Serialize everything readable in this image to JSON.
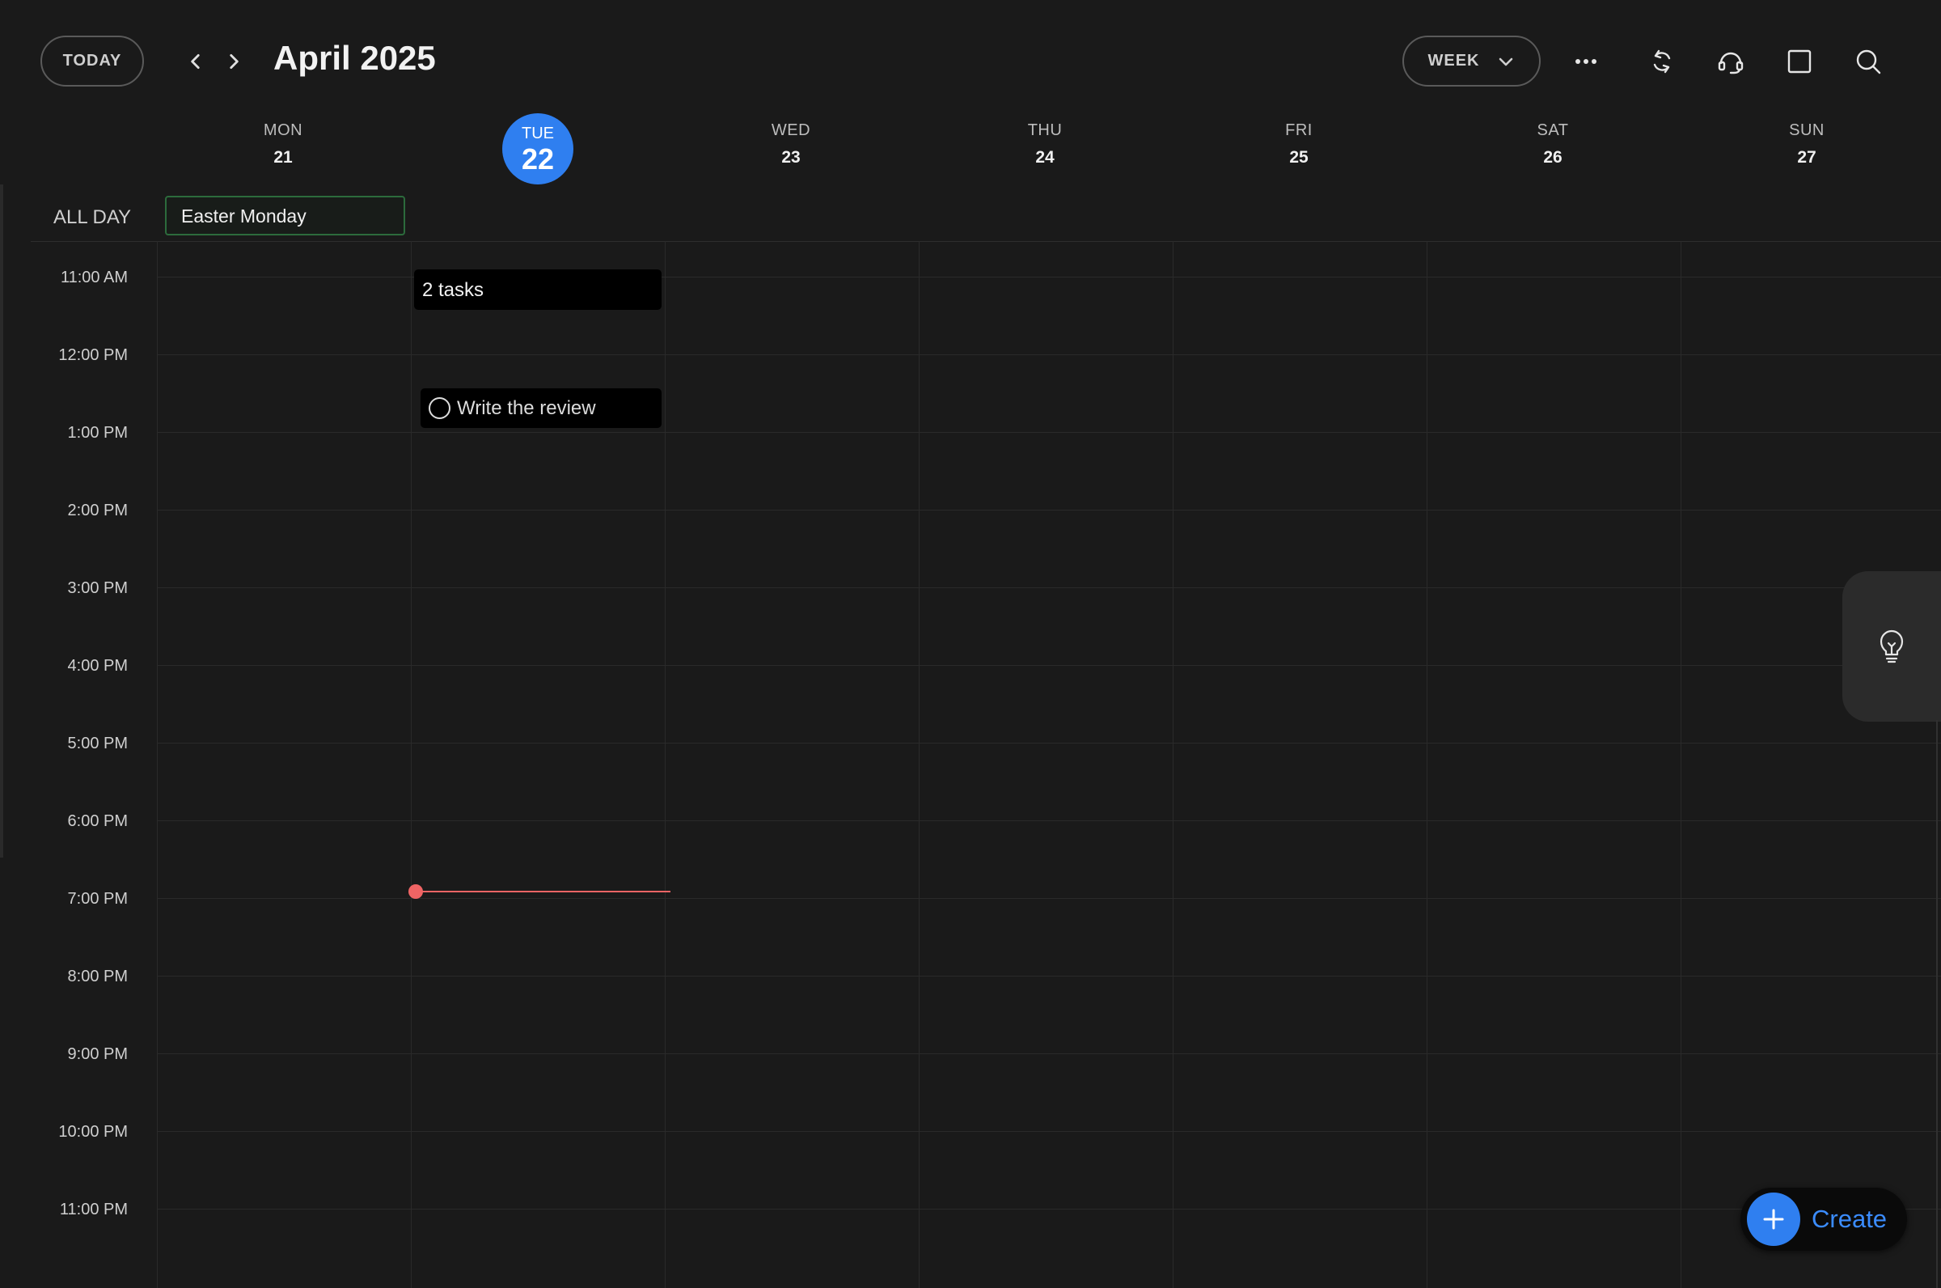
{
  "header": {
    "today_label": "TODAY",
    "month_title": "April 2025",
    "view_label": "WEEK",
    "icons": [
      "chevron-left-icon",
      "chevron-right-icon",
      "chevron-down-icon",
      "more-icon",
      "sync-icon",
      "support-icon",
      "square-icon",
      "search-icon"
    ]
  },
  "days": [
    {
      "name": "MON",
      "number": "21"
    },
    {
      "name": "TUE",
      "number": "22",
      "today": true
    },
    {
      "name": "WED",
      "number": "23"
    },
    {
      "name": "THU",
      "number": "24"
    },
    {
      "name": "FRI",
      "number": "25"
    },
    {
      "name": "SAT",
      "number": "26"
    },
    {
      "name": "SUN",
      "number": "27"
    }
  ],
  "all_day": {
    "label": "ALL DAY",
    "events": [
      {
        "title": "Easter Monday",
        "day": "MON",
        "color": "#2c6b3c"
      }
    ]
  },
  "hours": [
    "11:00 AM",
    "12:00 PM",
    "1:00 PM",
    "2:00 PM",
    "3:00 PM",
    "4:00 PM",
    "5:00 PM",
    "6:00 PM",
    "7:00 PM",
    "8:00 PM",
    "9:00 PM",
    "10:00 PM",
    "11:00 PM"
  ],
  "events": {
    "tasks_summary": "2 tasks",
    "task_title": "Write the review"
  },
  "create_label": "Create",
  "colors": {
    "accent": "#2f7ff0",
    "now_indicator": "#ef6464",
    "background": "#1a1a1a"
  }
}
